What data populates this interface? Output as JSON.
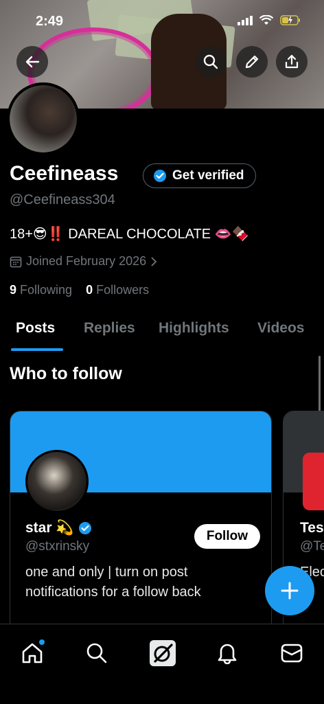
{
  "status_bar": {
    "time": "2:49"
  },
  "profile": {
    "name": "Ceefineass",
    "handle": "@Ceefineass304",
    "verify_button": "Get verified",
    "bio": "18+😎‼️ DAREAL CHOCOLATE 👄🍫",
    "joined": "Joined February 2026",
    "following_count": "9",
    "following_label": "Following",
    "followers_count": "0",
    "followers_label": "Followers"
  },
  "tabs": [
    "Posts",
    "Replies",
    "Highlights",
    "Videos"
  ],
  "who_to_follow": {
    "title": "Who to follow",
    "cards": [
      {
        "name": "star 💫",
        "handle": "@stxrinsky",
        "follow_label": "Follow",
        "description": "one and only | turn on post notifications for a follow back"
      },
      {
        "name": "Tes",
        "handle": "@Te",
        "description": "Elec\nsc"
      }
    ]
  },
  "colors": {
    "accent": "#1d9bf0",
    "background": "#000000",
    "secondary_text": "#71767b"
  },
  "icons": {
    "top_bar": [
      "back-arrow-icon",
      "search-icon",
      "edit-pencil-icon",
      "share-icon"
    ],
    "nav": [
      "home-icon",
      "search-icon",
      "grok-icon",
      "notifications-bell-icon",
      "messages-envelope-icon"
    ]
  }
}
